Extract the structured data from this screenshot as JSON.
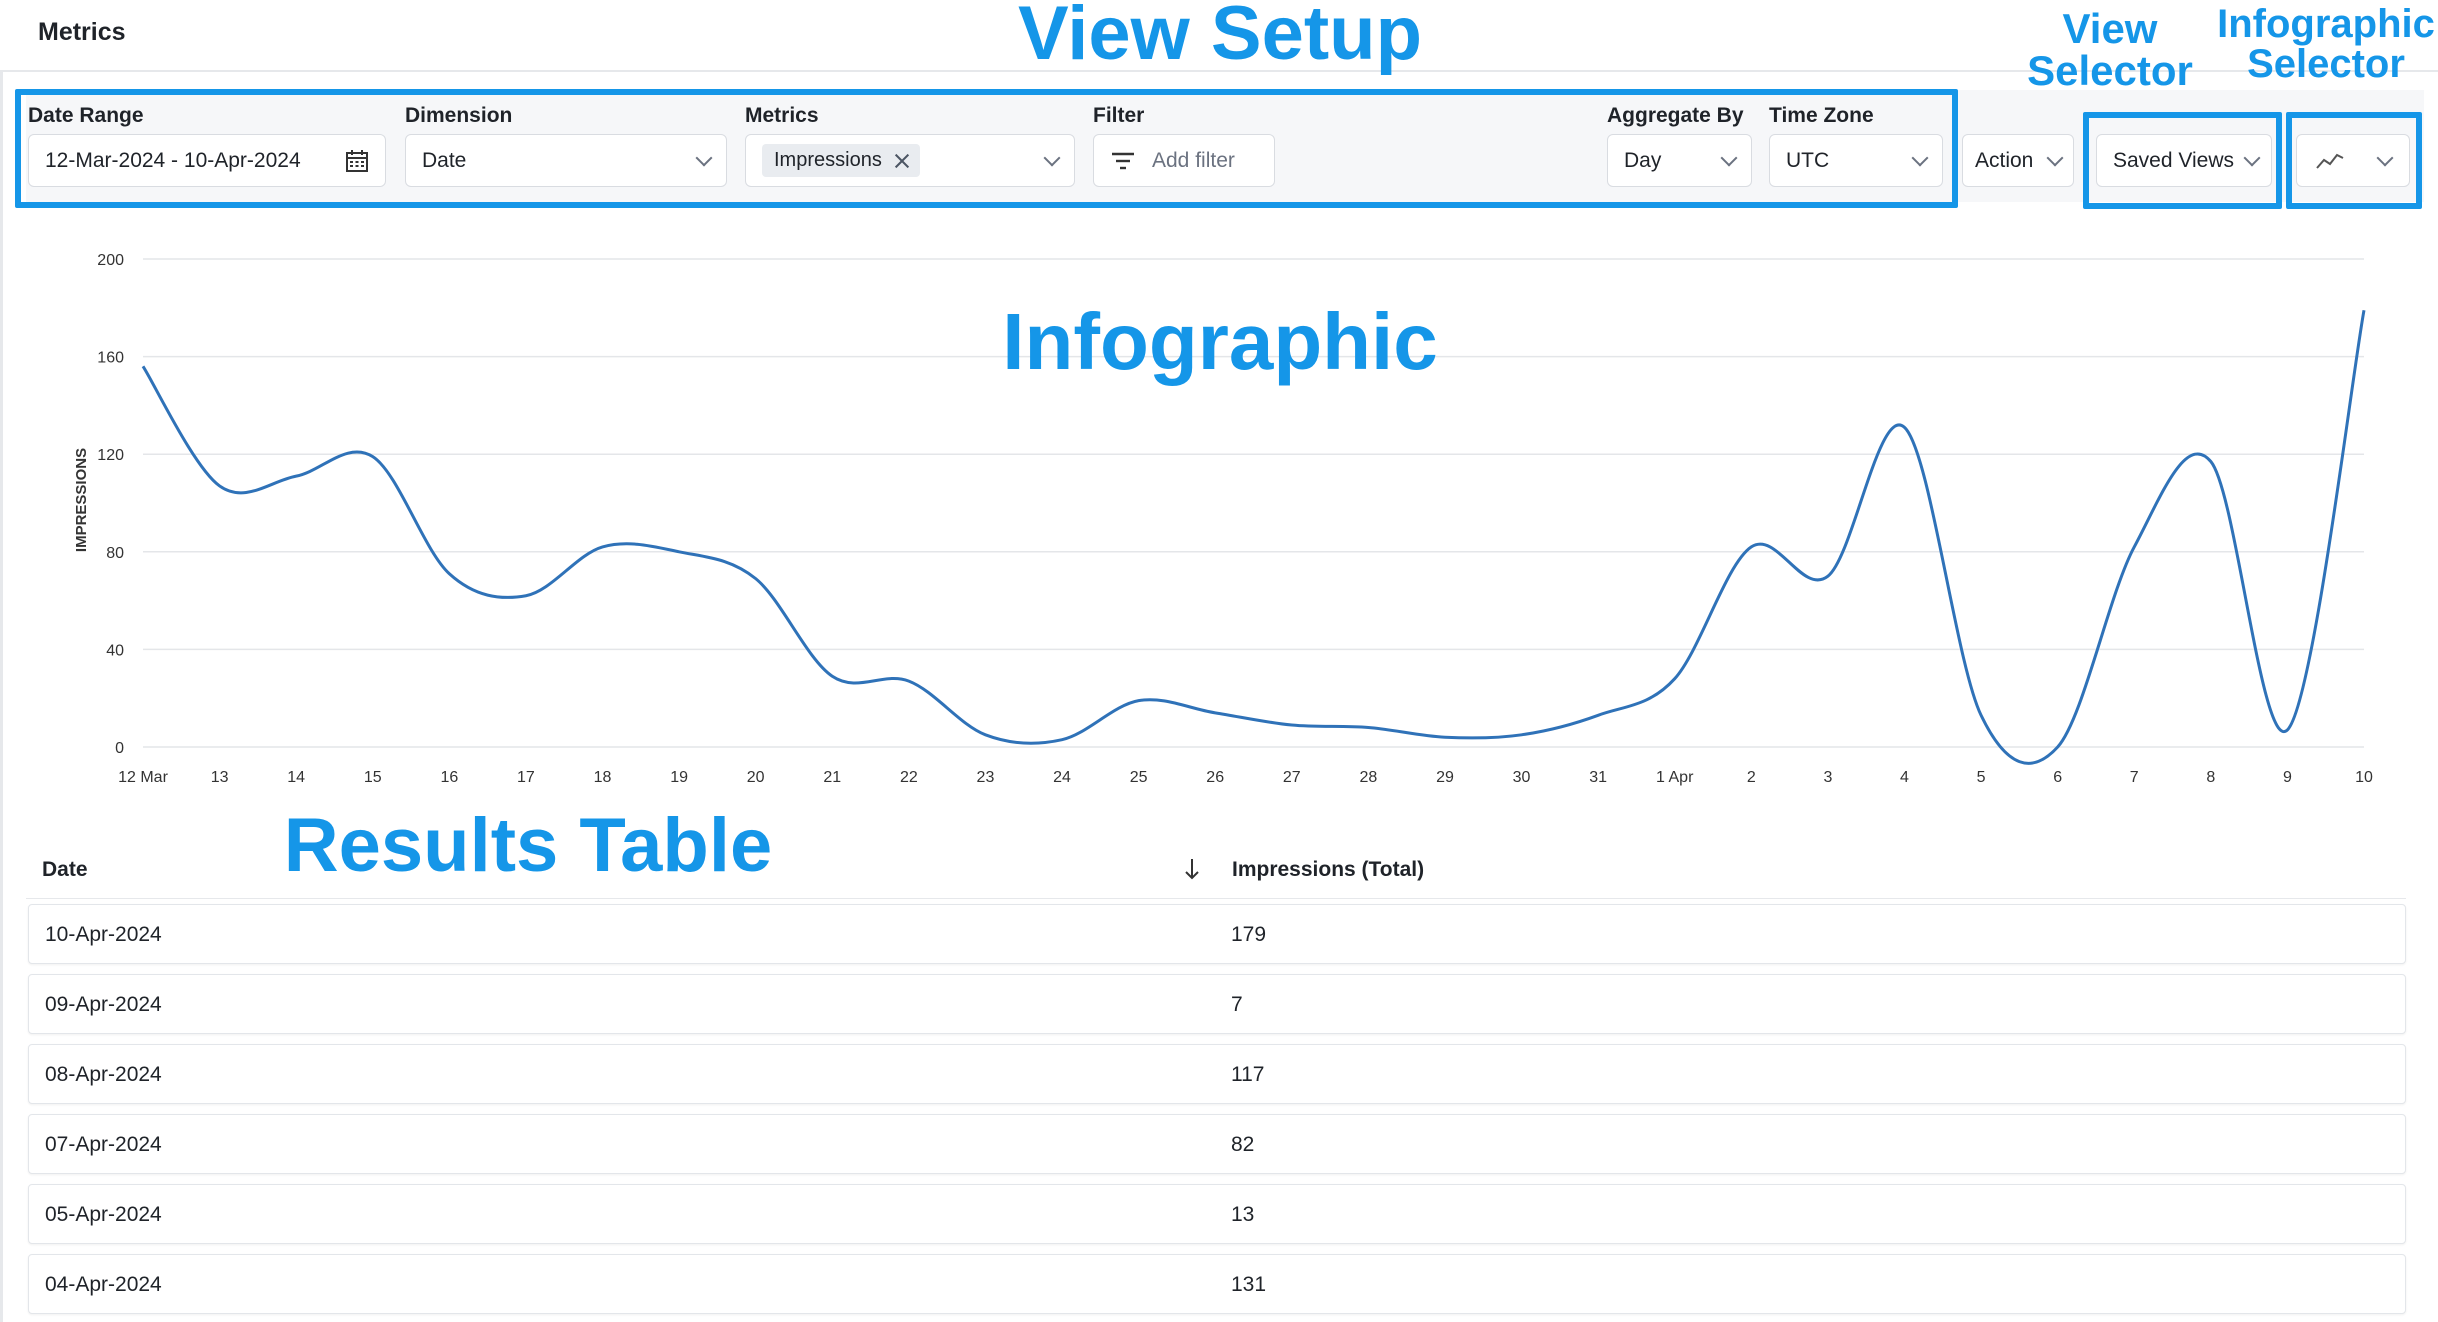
{
  "page": {
    "title": "Metrics"
  },
  "toolbar": {
    "date_range": {
      "label": "Date Range",
      "value": "12-Mar-2024 - 10-Apr-2024"
    },
    "dimension": {
      "label": "Dimension",
      "value": "Date"
    },
    "metrics": {
      "label": "Metrics",
      "tag": "Impressions"
    },
    "filter": {
      "label": "Filter",
      "placeholder": "Add filter"
    },
    "aggregate_by": {
      "label": "Aggregate By",
      "value": "Day"
    },
    "time_zone": {
      "label": "Time Zone",
      "value": "UTC"
    },
    "action": {
      "label": "Action"
    },
    "saved_views": {
      "label": "Saved Views"
    },
    "chart_selector_icon": "line-chart-icon"
  },
  "annotations": {
    "view_setup": "View Setup",
    "view_selector": "View Selector",
    "infographic_selector": "Infographic Selector",
    "infographic": "Infographic",
    "results_table": "Results Table"
  },
  "colors": {
    "accent": "#1596e8",
    "line": "#2f72b8"
  },
  "chart_data": {
    "type": "line",
    "ylabel": "IMPRESSIONS",
    "xlabel": "",
    "ylim": [
      0,
      200
    ],
    "yticks": [
      0,
      40,
      80,
      120,
      160,
      200
    ],
    "grid": true,
    "x": [
      "12 Mar",
      "13",
      "14",
      "15",
      "16",
      "17",
      "18",
      "19",
      "20",
      "21",
      "22",
      "23",
      "24",
      "25",
      "26",
      "27",
      "28",
      "29",
      "30",
      "31",
      "1 Apr",
      "2",
      "3",
      "4",
      "5",
      "6",
      "7",
      "8",
      "9",
      "10"
    ],
    "series": [
      {
        "values": [
          156,
          107,
          111,
          119,
          71,
          62,
          82,
          80,
          69,
          29,
          27,
          5,
          3,
          19,
          14,
          9,
          8,
          4,
          5,
          13,
          28,
          82,
          70,
          131,
          13,
          0,
          82,
          117,
          7,
          179
        ]
      }
    ]
  },
  "table": {
    "columns": [
      "Date",
      "Impressions (Total)"
    ],
    "rows": [
      [
        "10-Apr-2024",
        "179"
      ],
      [
        "09-Apr-2024",
        "7"
      ],
      [
        "08-Apr-2024",
        "117"
      ],
      [
        "07-Apr-2024",
        "82"
      ],
      [
        "05-Apr-2024",
        "13"
      ],
      [
        "04-Apr-2024",
        "131"
      ]
    ]
  }
}
